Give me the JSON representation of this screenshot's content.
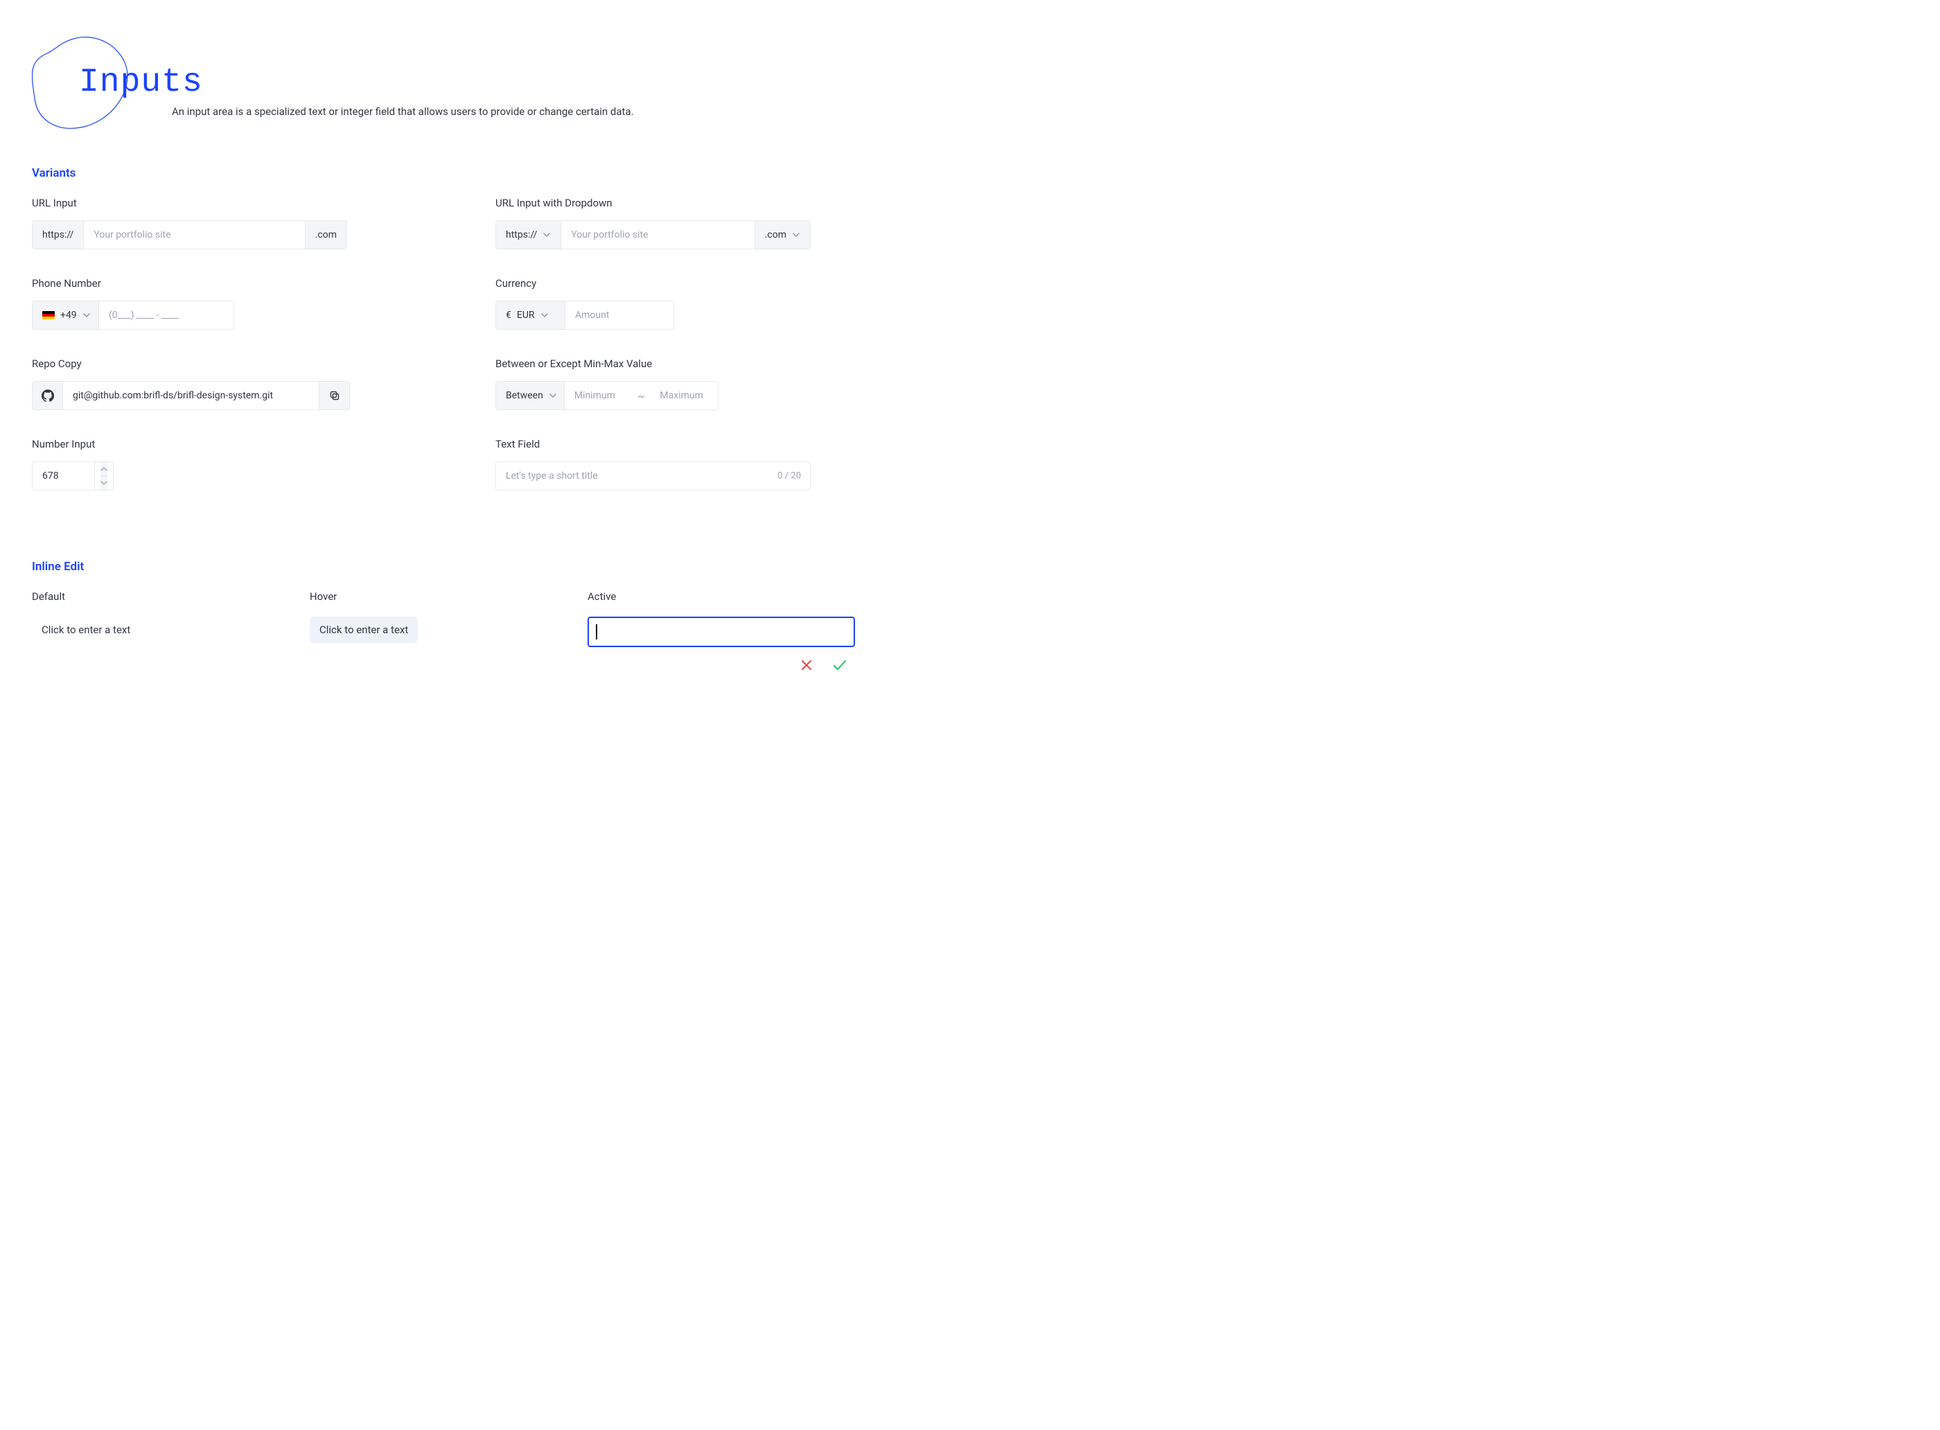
{
  "header": {
    "title": "Inputs",
    "subtitle": "An input area is a specialized text or integer field that allows users to provide or change certain data."
  },
  "section_variants_title": "Variants",
  "section_inline_title": "Inline Edit",
  "variants": {
    "url": {
      "label": "URL Input",
      "prefix": "https://",
      "placeholder": "Your portfolio site",
      "suffix": ".com"
    },
    "url_dd": {
      "label": "URL Input with Dropdown",
      "prefix": "https://",
      "placeholder": "Your portfolio site",
      "suffix": ".com"
    },
    "phone": {
      "label": "Phone Number",
      "country_code": "+49",
      "placeholder": "(0___)  ____ - ____"
    },
    "currency": {
      "label": "Currency",
      "symbol": "€",
      "code": "EUR",
      "placeholder": "Amount"
    },
    "repo": {
      "label": "Repo Copy",
      "value": "git@github.com:brifl-ds/brifl-design-system.git"
    },
    "between": {
      "label": "Between or Except Min-Max Value",
      "mode": "Between",
      "min_placeholder": "Minimum",
      "separator": "~",
      "max_placeholder": "Maximum"
    },
    "number": {
      "label": "Number Input",
      "value": "678"
    },
    "text": {
      "label": "Text Field",
      "placeholder": "Let's type a short title",
      "counter": "0 / 20"
    }
  },
  "inline": {
    "default": {
      "label": "Default",
      "text": "Click to enter a text"
    },
    "hover": {
      "label": "Hover",
      "text": "Click to enter a text"
    },
    "active": {
      "label": "Active",
      "value": ""
    }
  },
  "colors": {
    "accent": "#1a42ff",
    "danger": "#ef4444",
    "success": "#22c55e"
  }
}
